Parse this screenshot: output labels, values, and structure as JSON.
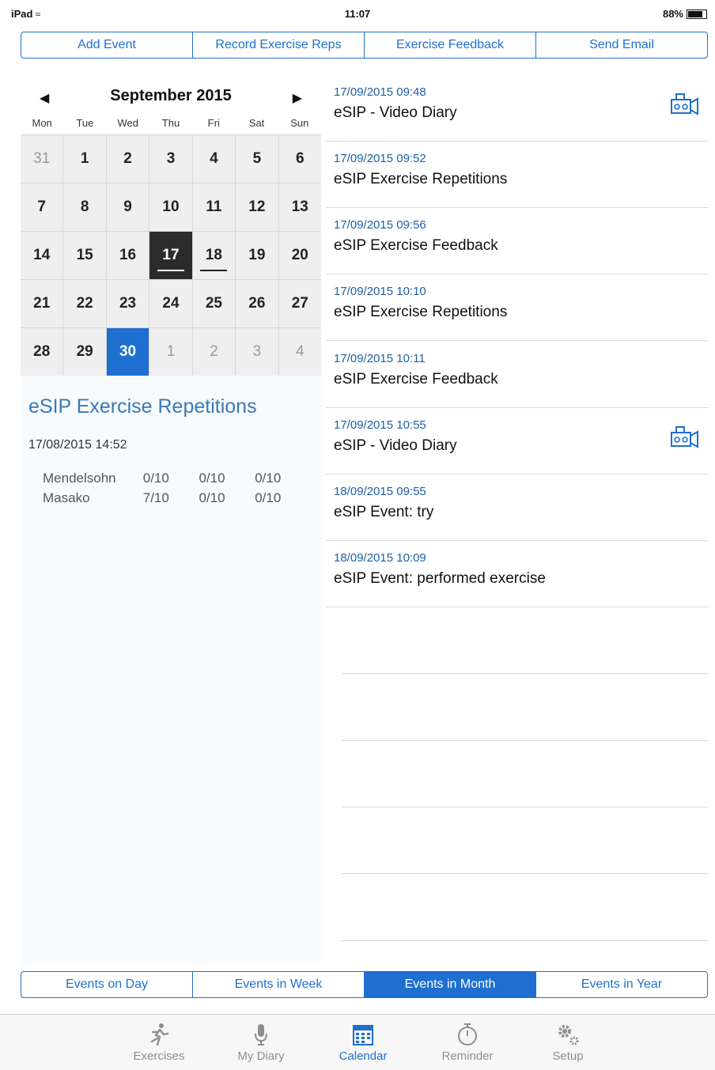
{
  "status_bar": {
    "carrier": "iPad",
    "time": "11:07",
    "battery": "88%"
  },
  "top_segments": [
    "Add Event",
    "Record Exercise Reps",
    "Exercise Feedback",
    "Send Email"
  ],
  "calendar": {
    "month_label": "September 2015",
    "weekdays": [
      "Mon",
      "Tue",
      "Wed",
      "Thu",
      "Fri",
      "Sat",
      "Sun"
    ],
    "days": [
      {
        "n": "31",
        "other": true
      },
      {
        "n": "1"
      },
      {
        "n": "2"
      },
      {
        "n": "3"
      },
      {
        "n": "4"
      },
      {
        "n": "5"
      },
      {
        "n": "6"
      },
      {
        "n": "7"
      },
      {
        "n": "8"
      },
      {
        "n": "9"
      },
      {
        "n": "10"
      },
      {
        "n": "11"
      },
      {
        "n": "12"
      },
      {
        "n": "13"
      },
      {
        "n": "14"
      },
      {
        "n": "15"
      },
      {
        "n": "16"
      },
      {
        "n": "17",
        "today": true,
        "has_events": true
      },
      {
        "n": "18",
        "has_events": true
      },
      {
        "n": "19"
      },
      {
        "n": "20"
      },
      {
        "n": "21"
      },
      {
        "n": "22"
      },
      {
        "n": "23"
      },
      {
        "n": "24"
      },
      {
        "n": "25"
      },
      {
        "n": "26"
      },
      {
        "n": "27"
      },
      {
        "n": "28"
      },
      {
        "n": "29"
      },
      {
        "n": "30",
        "selected": true
      },
      {
        "n": "1",
        "other": true
      },
      {
        "n": "2",
        "other": true
      },
      {
        "n": "3",
        "other": true
      },
      {
        "n": "4",
        "other": true
      }
    ]
  },
  "detail": {
    "title": "eSIP Exercise Repetitions",
    "date": "17/08/2015 14:52",
    "rows": [
      {
        "name": "Mendelsohn",
        "values": [
          "0/10",
          "0/10",
          "0/10"
        ]
      },
      {
        "name": "Masako",
        "values": [
          "7/10",
          "0/10",
          "0/10"
        ]
      }
    ]
  },
  "events": [
    {
      "timestamp": "17/09/2015 09:48",
      "title": "eSIP - Video Diary",
      "icon": "video-camera-icon"
    },
    {
      "timestamp": "17/09/2015 09:52",
      "title": "eSIP Exercise Repetitions"
    },
    {
      "timestamp": "17/09/2015 09:56",
      "title": "eSIP Exercise Feedback"
    },
    {
      "timestamp": "17/09/2015 10:10",
      "title": "eSIP Exercise Repetitions"
    },
    {
      "timestamp": "17/09/2015 10:11",
      "title": "eSIP Exercise Feedback"
    },
    {
      "timestamp": "17/09/2015 10:55",
      "title": "eSIP - Video Diary",
      "icon": "video-camera-icon"
    },
    {
      "timestamp": "18/09/2015 09:55",
      "title": "eSIP Event: try"
    },
    {
      "timestamp": "18/09/2015 10:09",
      "title": "eSIP Event: performed exercise"
    }
  ],
  "bottom_segments": {
    "items": [
      "Events on Day",
      "Events in Week",
      "Events in Month",
      "Events in Year"
    ],
    "active_index": 2
  },
  "tabbar": {
    "items": [
      {
        "label": "Exercises",
        "icon": "running-person-icon"
      },
      {
        "label": "My Diary",
        "icon": "microphone-icon"
      },
      {
        "label": "Calendar",
        "icon": "calendar-icon"
      },
      {
        "label": "Reminder",
        "icon": "stopwatch-icon"
      },
      {
        "label": "Setup",
        "icon": "gears-icon"
      }
    ],
    "active_index": 2
  },
  "colors": {
    "accent": "#1e6fcf",
    "timestamp": "#1e5fa8",
    "today_bg": "#2b2b2b",
    "detail_title": "#3b78b6"
  }
}
